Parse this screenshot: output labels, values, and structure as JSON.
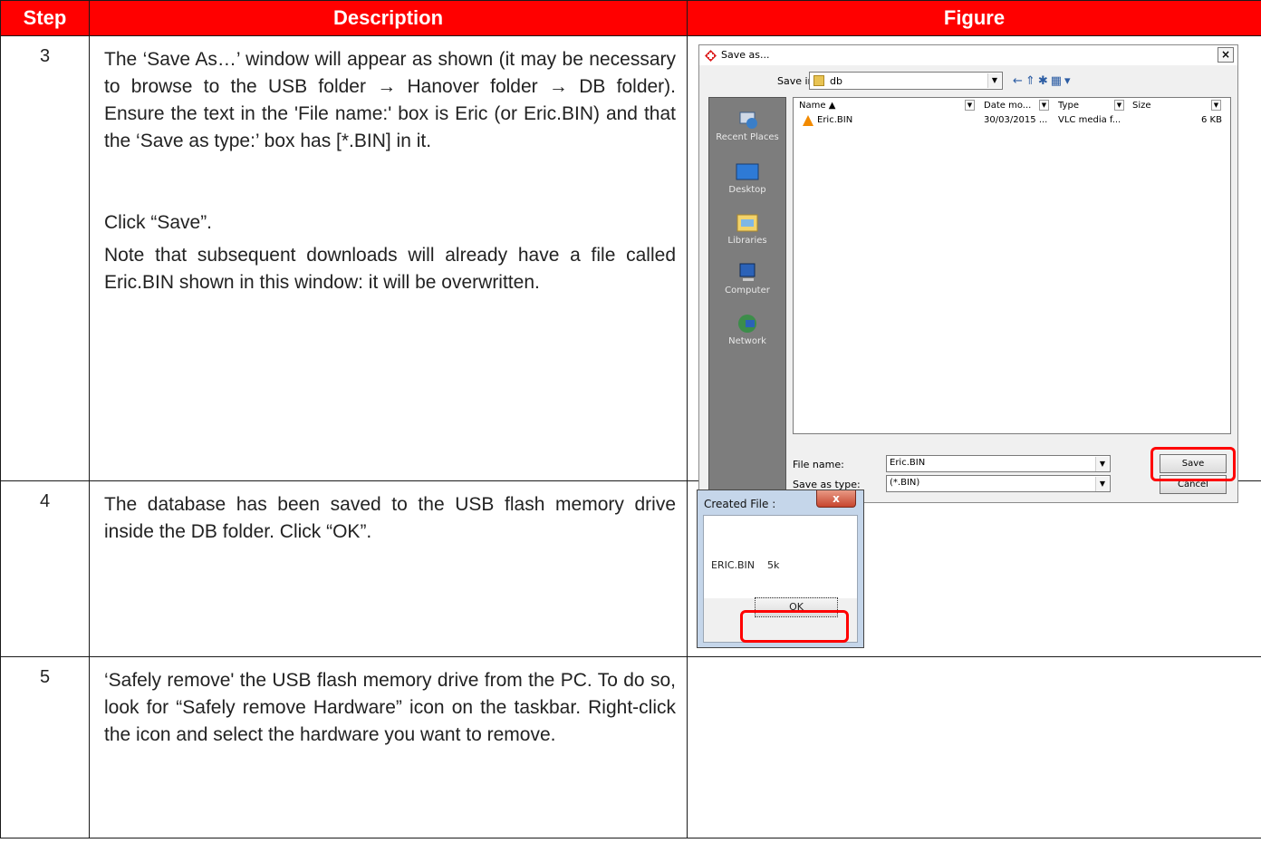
{
  "table": {
    "headers": {
      "step": "Step",
      "description": "Description",
      "figure": "Figure"
    },
    "header_color": "#ff0000",
    "rows": [
      {
        "step": "3",
        "description": [
          "The ‘Save As…’ window will appear as shown (it may be necessary to browse to the USB folder → Hanover folder → DB folder). Ensure the text in the 'File name:' box is Eric (or Eric.BIN) and that the ‘Save as type:’ box has [*.BIN] in it.",
          "Click “Save”.",
          "Note that subsequent downloads will already have a file called Eric.BIN shown in this window: it will be overwritten."
        ]
      },
      {
        "step": "4",
        "description": [
          "The database has been saved to the USB flash memory drive inside the DB folder. Click “OK”."
        ]
      },
      {
        "step": "5",
        "description": [
          "‘Safely remove' the USB flash memory drive from the PC. To do so, look for “Safely remove Hardware” icon on the taskbar. Right-click the icon and select the hardware you want to remove."
        ]
      }
    ]
  },
  "save_as_dialog": {
    "title": "Save as...",
    "close": "×",
    "save_in_label": "Save in:",
    "save_in_value": "db",
    "places": [
      "Recent Places",
      "Desktop",
      "Libraries",
      "Computer",
      "Network"
    ],
    "columns": [
      "Name",
      "Date mo...",
      "Type",
      "Size"
    ],
    "files": [
      {
        "name": "Eric.BIN",
        "date": "30/03/2015 ...",
        "type": "VLC media f...",
        "size": "6 KB"
      }
    ],
    "file_name_label": "File name:",
    "file_name_value": "Eric.BIN",
    "save_type_label": "Save as type:",
    "save_type_value": "(*.BIN)",
    "save_button": "Save",
    "cancel_button": "Cancel",
    "highlight_color": "#ff0000"
  },
  "created_dialog": {
    "title": "Created File :",
    "close": "x",
    "message": "ERIC.BIN    5k",
    "ok_button": "OK"
  }
}
